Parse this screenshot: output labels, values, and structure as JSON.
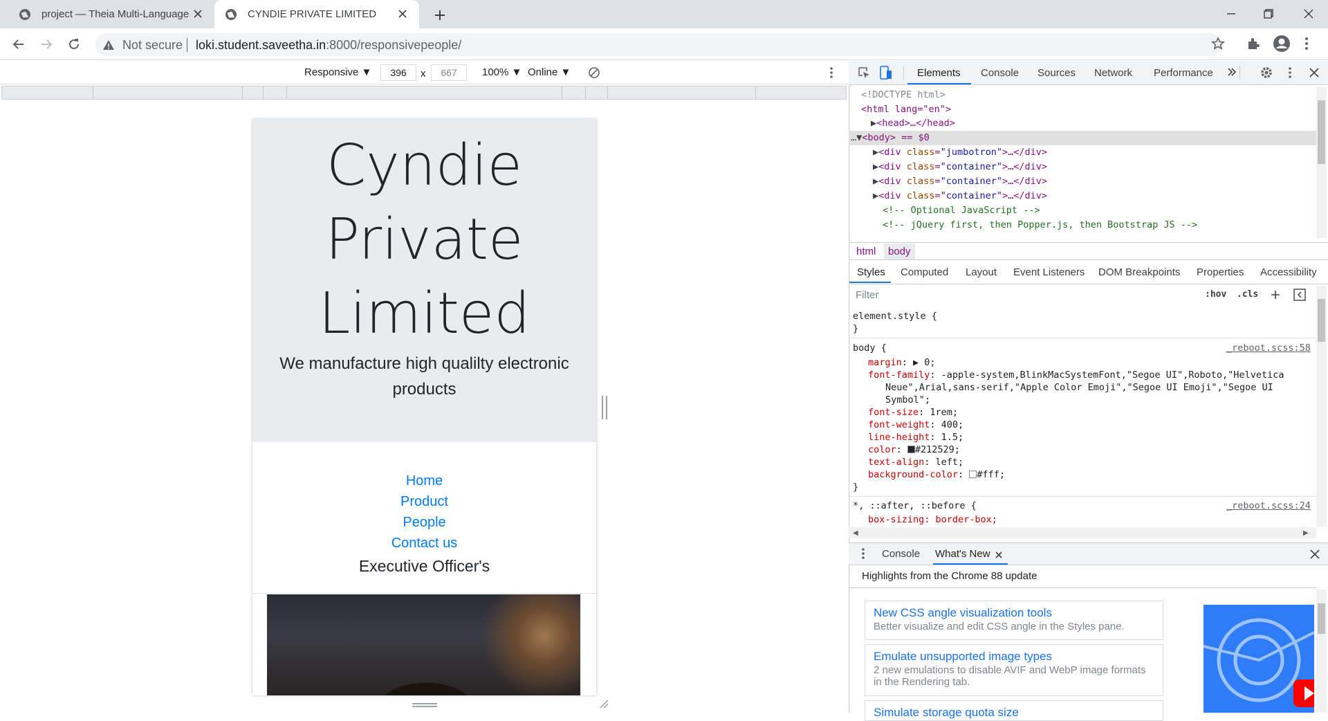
{
  "browser": {
    "tabs": [
      {
        "title": "project — Theia Multi-Language",
        "active": false
      },
      {
        "title": "CYNDIE PRIVATE LIMITED",
        "active": true
      }
    ],
    "security_label": "Not secure",
    "url_host": "loki.student.saveetha.in",
    "url_rest": ":8000/responsivepeople/"
  },
  "device_toolbar": {
    "mode": "Responsive ▼",
    "width": "396",
    "times": "x",
    "height": "667",
    "zoom": "100% ▼",
    "network": "Online ▼"
  },
  "page": {
    "title": "Cyndie Private Limited",
    "title_lines": [
      "Cyndie",
      "Private",
      "Limited"
    ],
    "subtitle": "We manufacture high qualilty electronic products",
    "nav": [
      "Home",
      "Product",
      "People",
      "Contact us"
    ],
    "section_heading": "Executive Officer's"
  },
  "devtools": {
    "tabs": [
      "Elements",
      "Console",
      "Sources",
      "Network",
      "Performance"
    ],
    "active_tab": "Elements",
    "dom": {
      "doctype": "<!DOCTYPE html>",
      "html_open": "<html lang=\"en\">",
      "head": "<head>…</head>",
      "body": "<body> == $0",
      "divs": [
        "jumbotron",
        "container",
        "container",
        "container"
      ],
      "comment1": "<!-- Optional JavaScript -->",
      "comment2": "<!-- jQuery first, then Popper.js, then Bootstrap JS -->"
    },
    "breadcrumbs": [
      "html",
      "body"
    ],
    "style_tabs": [
      "Styles",
      "Computed",
      "Layout",
      "Event Listeners",
      "DOM Breakpoints",
      "Properties",
      "Accessibility"
    ],
    "filter_placeholder": "Filter",
    "hov": ":hov",
    "cls": ".cls",
    "element_style": "element.style {",
    "body_rule": {
      "selector": "body {",
      "source": "_reboot.scss:58",
      "props": [
        {
          "name": "margin",
          "value": "▶ 0;"
        },
        {
          "name": "font-family",
          "value": "-apple-system,BlinkMacSystemFont,\"Segoe UI\",Roboto,\"Helvetica"
        },
        {
          "name": "",
          "value": "Neue\",Arial,sans-serif,\"Apple Color Emoji\",\"Segoe UI Emoji\",\"Segoe UI"
        },
        {
          "name": "",
          "value": "Symbol\";"
        },
        {
          "name": "font-size",
          "value": "1rem;"
        },
        {
          "name": "font-weight",
          "value": "400;"
        },
        {
          "name": "line-height",
          "value": "1.5;"
        },
        {
          "name": "color",
          "value": "#212529;"
        },
        {
          "name": "text-align",
          "value": "left;"
        },
        {
          "name": "background-color",
          "value": "#fff;"
        }
      ]
    },
    "universal_rule": {
      "selector": "*, ::after, ::before {",
      "source": "_reboot.scss:24",
      "prop": "box-sizing: border-box;"
    },
    "drawer": {
      "tabs": [
        "Console",
        "What's New"
      ],
      "headline": "Highlights from the Chrome 88 update",
      "items": [
        {
          "title": "New CSS angle visualization tools",
          "desc": "Better visualize and edit CSS angle in the Styles pane."
        },
        {
          "title": "Emulate unsupported image types",
          "desc": "2 new emulations to disable AVIF and WebP image formats in the Rendering tab."
        },
        {
          "title": "Simulate storage quota size",
          "desc": ""
        }
      ]
    }
  },
  "colors": {
    "link": "#007bff",
    "jumbotron": "#e9ecef",
    "devtools_accent": "#1a73e8",
    "swatch_color": "#212529",
    "swatch_bg": "#fff"
  }
}
